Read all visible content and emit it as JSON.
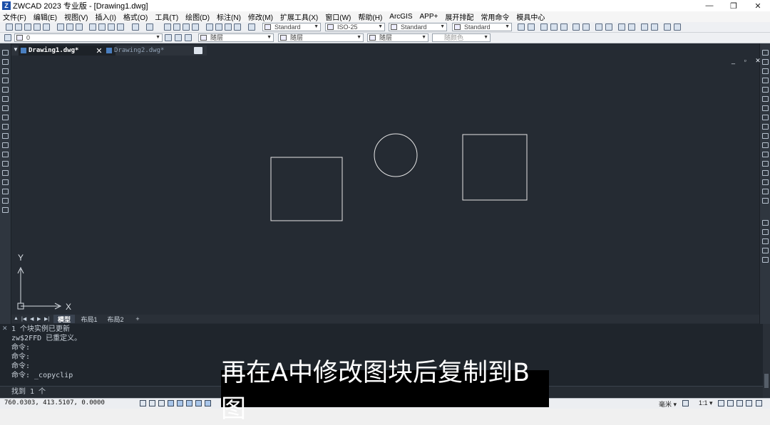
{
  "window": {
    "title": "ZWCAD 2023 专业版 - [Drawing1.dwg]",
    "logo_letter": "Z",
    "controls": [
      "—",
      "❐",
      "✕"
    ]
  },
  "menu": [
    "文件(F)",
    "编辑(E)",
    "视图(V)",
    "插入(I)",
    "格式(O)",
    "工具(T)",
    "绘图(D)",
    "标注(N)",
    "修改(M)",
    "扩展工具(X)",
    "窗口(W)",
    "帮助(H)",
    "ArcGIS",
    "APP+",
    "展开排配",
    "常用命令",
    "模具中心"
  ],
  "toolbar": {
    "text_style": "Standard",
    "dim_style": "ISO-25",
    "table_style": "Standard",
    "multileader_style": "Standard",
    "layer": "0",
    "color": "随层",
    "linetype": "随层",
    "lineweight": "随层",
    "plot_style": "随颜色"
  },
  "document_tabs": [
    {
      "label": "Drawing1.dwg*",
      "active": true
    },
    {
      "label": "Drawing2.dwg*",
      "active": false
    }
  ],
  "tab_close": "✕",
  "doc_controls": "_ ▫ ✕",
  "canvas": {
    "background": "#252b33",
    "stroke": "#e6e6e6",
    "ucs_y": "Y",
    "ucs_x": "X"
  },
  "layout_tabs": {
    "nav": [
      "▲",
      "|◀",
      "◀",
      "▶",
      "▶|"
    ],
    "tabs": [
      "模型",
      "布局1",
      "布局2",
      "+"
    ]
  },
  "command": {
    "close": "✕",
    "history": [
      "1 个块实例已更新",
      "zw$2FFD 已重定义。",
      "命令:",
      "命令:",
      "命令:",
      "命令: _copyclip"
    ],
    "prompt": "找到 1 个"
  },
  "status": {
    "coords": "760.0303, 413.5107, 0.0000",
    "units": "毫米 ▾",
    "scale": "1:1 ▾"
  },
  "subtitle": "再在A中修改图块后复制到B图"
}
